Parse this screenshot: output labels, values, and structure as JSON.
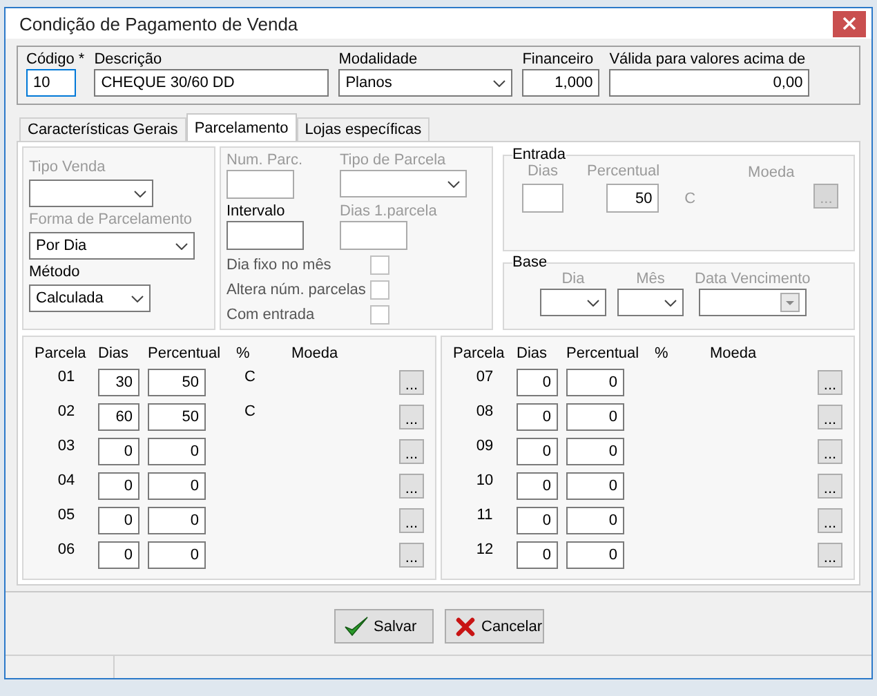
{
  "window": {
    "title": "Condição de Pagamento de Venda"
  },
  "header": {
    "fields": [
      {
        "label": "Código *",
        "kind": "text",
        "value": "10",
        "focused": true
      },
      {
        "label": "Descrição",
        "kind": "text",
        "value": "CHEQUE 30/60 DD",
        "focused": false
      },
      {
        "label": "Modalidade",
        "kind": "select",
        "value": "Planos",
        "focused": false
      },
      {
        "label": "Financeiro",
        "kind": "number",
        "value": "1,000",
        "focused": false
      },
      {
        "label": "Válida para valores acima de",
        "kind": "number",
        "value": "0,00",
        "focused": false
      }
    ]
  },
  "tabs": [
    {
      "label": "Características Gerais",
      "selected": false
    },
    {
      "label": "Parcelamento",
      "selected": true
    },
    {
      "label": "Lojas específicas",
      "selected": false
    }
  ],
  "left_panel": [
    {
      "label": "Tipo Venda",
      "kind": "select",
      "disabled": true
    },
    {
      "label": "Forma de Parcelamento",
      "kind": "select",
      "value": "Por Dia",
      "disabled": true
    },
    {
      "label": "Método",
      "kind": "select",
      "value": "Calculada",
      "disabled": false
    }
  ],
  "middle_panel": {
    "fields": [
      {
        "label": "Num. Parc.",
        "kind": "text",
        "disabled": true
      },
      {
        "label": "Tipo de Parcela",
        "kind": "select",
        "disabled": true
      },
      {
        "label": "Intervalo",
        "kind": "text",
        "disabled": false
      },
      {
        "label": "Dias 1.parcela",
        "kind": "text",
        "disabled": true
      }
    ],
    "checkboxes": [
      {
        "label": "Dia fixo no mês",
        "checked": false
      },
      {
        "label": "Altera núm. parcelas",
        "checked": false
      },
      {
        "label": "Com entrada",
        "checked": false
      }
    ]
  },
  "entrada": {
    "title": "Entrada",
    "dias_label": "Dias",
    "percentual_label": "Percentual",
    "moeda_label": "Moeda",
    "percentual": "50",
    "currency": "C",
    "moeda_button": "..."
  },
  "base": {
    "title": "Base",
    "fields": [
      {
        "label": "Dia",
        "kind": "select"
      },
      {
        "label": "Mês",
        "kind": "select"
      },
      {
        "label": "Data Vencimento",
        "kind": "date"
      }
    ]
  },
  "grids": [
    {
      "columns": [
        "Parcela",
        "Dias",
        "Percentual",
        "%",
        "Moeda"
      ],
      "rows": [
        {
          "parcela": "01",
          "dias": "30",
          "percentual": "50",
          "currency": "C",
          "button": "..."
        },
        {
          "parcela": "02",
          "dias": "60",
          "percentual": "50",
          "currency": "C",
          "button": "..."
        },
        {
          "parcela": "03",
          "dias": "0",
          "percentual": "0",
          "button": "..."
        },
        {
          "parcela": "04",
          "dias": "0",
          "percentual": "0",
          "button": "..."
        },
        {
          "parcela": "05",
          "dias": "0",
          "percentual": "0",
          "button": "..."
        },
        {
          "parcela": "06",
          "dias": "0",
          "percentual": "0",
          "button": "..."
        }
      ]
    },
    {
      "columns": [
        "Parcela",
        "Dias",
        "Percentual",
        "%",
        "Moeda"
      ],
      "rows": [
        {
          "parcela": "07",
          "dias": "0",
          "percentual": "0",
          "button": "..."
        },
        {
          "parcela": "08",
          "dias": "0",
          "percentual": "0",
          "button": "..."
        },
        {
          "parcela": "09",
          "dias": "0",
          "percentual": "0",
          "button": "..."
        },
        {
          "parcela": "10",
          "dias": "0",
          "percentual": "0",
          "button": "..."
        },
        {
          "parcela": "11",
          "dias": "0",
          "percentual": "0",
          "button": "..."
        },
        {
          "parcela": "12",
          "dias": "0",
          "percentual": "0",
          "button": "..."
        }
      ]
    }
  ],
  "buttons": [
    {
      "label": "Salvar",
      "kind": "save"
    },
    {
      "label": "Cancelar",
      "kind": "cancel"
    }
  ]
}
